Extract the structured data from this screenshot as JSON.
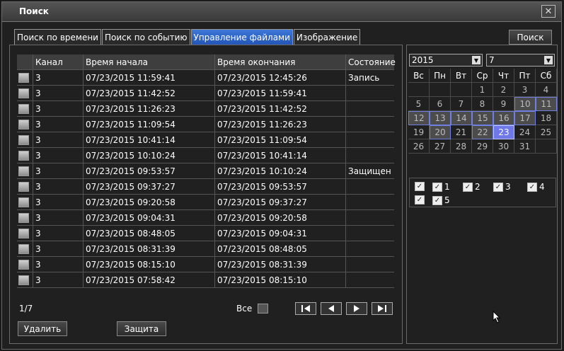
{
  "window": {
    "title": "Поиск",
    "close_glyph": "✕"
  },
  "tabs": [
    {
      "label": "Поиск по времени",
      "active": false
    },
    {
      "label": "Поиск по событию",
      "active": false
    },
    {
      "label": "Управление файлами",
      "active": true
    },
    {
      "label": "Изображение",
      "active": false
    }
  ],
  "search_button": "Поиск",
  "table": {
    "headers": [
      "Канал",
      "Время начала",
      "Время окончания",
      "Состояние"
    ],
    "rows": [
      {
        "channel": "3",
        "start": "07/23/2015 11:59:41",
        "end": "07/23/2015 12:45:26",
        "state": "Запись"
      },
      {
        "channel": "3",
        "start": "07/23/2015 11:42:52",
        "end": "07/23/2015 11:59:41",
        "state": ""
      },
      {
        "channel": "3",
        "start": "07/23/2015 11:26:23",
        "end": "07/23/2015 11:42:52",
        "state": ""
      },
      {
        "channel": "3",
        "start": "07/23/2015 11:09:54",
        "end": "07/23/2015 11:26:23",
        "state": ""
      },
      {
        "channel": "3",
        "start": "07/23/2015 10:41:14",
        "end": "07/23/2015 11:09:54",
        "state": ""
      },
      {
        "channel": "3",
        "start": "07/23/2015 10:10:24",
        "end": "07/23/2015 10:41:14",
        "state": ""
      },
      {
        "channel": "3",
        "start": "07/23/2015 09:53:57",
        "end": "07/23/2015 10:10:24",
        "state": "Защищен"
      },
      {
        "channel": "3",
        "start": "07/23/2015 09:37:27",
        "end": "07/23/2015 09:53:57",
        "state": ""
      },
      {
        "channel": "3",
        "start": "07/23/2015 09:20:58",
        "end": "07/23/2015 09:37:27",
        "state": ""
      },
      {
        "channel": "3",
        "start": "07/23/2015 09:04:31",
        "end": "07/23/2015 09:20:58",
        "state": ""
      },
      {
        "channel": "3",
        "start": "07/23/2015 08:48:05",
        "end": "07/23/2015 09:04:31",
        "state": ""
      },
      {
        "channel": "3",
        "start": "07/23/2015 08:31:39",
        "end": "07/23/2015 08:48:05",
        "state": ""
      },
      {
        "channel": "3",
        "start": "07/23/2015 08:15:10",
        "end": "07/23/2015 08:31:39",
        "state": ""
      },
      {
        "channel": "3",
        "start": "07/23/2015 07:58:42",
        "end": "07/23/2015 08:15:10",
        "state": ""
      }
    ]
  },
  "footer": {
    "page": "1/7",
    "all_label": "Все"
  },
  "pager_icons": [
    "first-page-icon",
    "prev-page-icon",
    "next-page-icon",
    "last-page-icon"
  ],
  "actions": {
    "delete": "Удалить",
    "protect": "Защита"
  },
  "calendar": {
    "year": "2015",
    "month": "7",
    "weekdays": [
      "Вс",
      "Пн",
      "Вт",
      "Ср",
      "Чт",
      "Пт",
      "Сб"
    ],
    "weeks": [
      [
        "",
        "",
        "",
        "1",
        "2",
        "3",
        "4"
      ],
      [
        "5",
        "6",
        "7",
        "8",
        "9",
        "10",
        "11"
      ],
      [
        "12",
        "13",
        "14",
        "15",
        "16",
        "17",
        "18"
      ],
      [
        "19",
        "20",
        "21",
        "22",
        "23",
        "24",
        "25"
      ],
      [
        "26",
        "27",
        "28",
        "29",
        "30",
        "31",
        ""
      ]
    ],
    "record_days": [
      "10",
      "11",
      "12",
      "13",
      "14",
      "15",
      "16",
      "17",
      "20",
      "22"
    ],
    "selected_day": "23"
  },
  "channels": {
    "all_checked": true,
    "items": [
      {
        "label": "1",
        "checked": true
      },
      {
        "label": "2",
        "checked": true
      },
      {
        "label": "3",
        "checked": true
      },
      {
        "label": "4",
        "checked": true
      },
      {
        "label": "5",
        "checked": true
      }
    ]
  },
  "colors": {
    "accent": "#2e62c6",
    "record_day_border": "#7080e0",
    "selected_day": "#6e78e6"
  }
}
